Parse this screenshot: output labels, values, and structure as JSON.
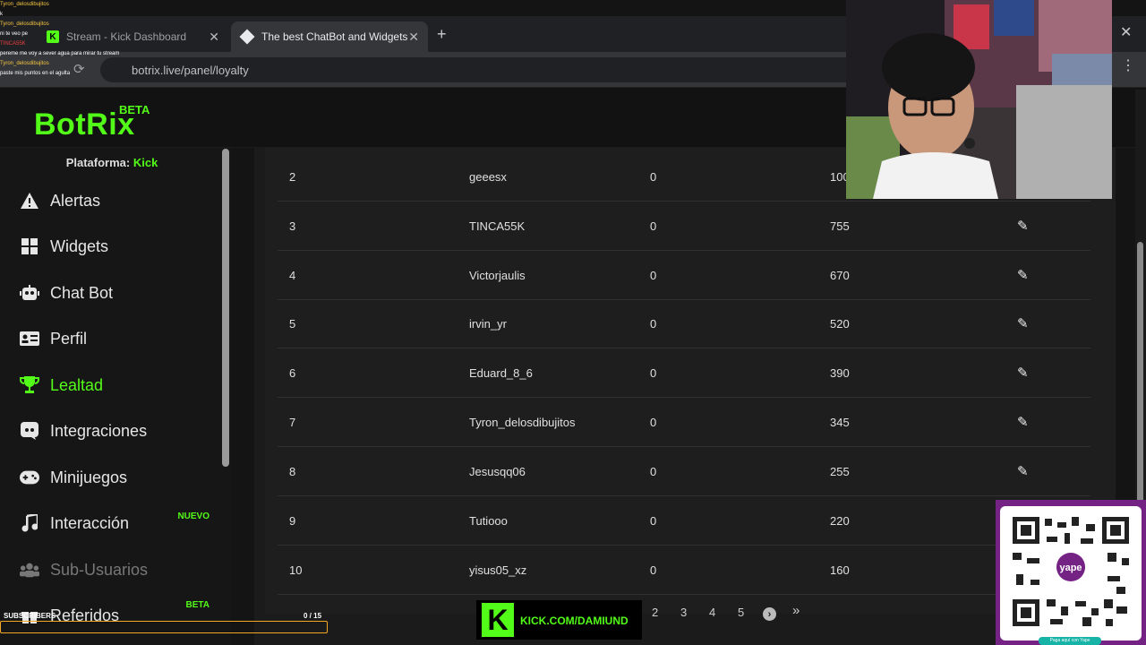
{
  "chat_overlay": {
    "lines": [
      {
        "user": "Tyron_delosdibujitos",
        "text": ""
      },
      {
        "user": "",
        "text": "k"
      },
      {
        "user": "Tyron_delosdibujitos",
        "text": ""
      },
      {
        "user": "",
        "text": "ni te veo pe"
      },
      {
        "user": "TINCA55K",
        "text": ""
      },
      {
        "user": "",
        "text": "pereme me voy a sever agua para mirar tu stream"
      },
      {
        "user": "Tyron_delosdibujitos",
        "text": ""
      },
      {
        "user": "",
        "text": "paste mis puntos en el agulta"
      }
    ]
  },
  "browser": {
    "tabs": [
      {
        "label": "Stream - Kick Dashboard",
        "active": false
      },
      {
        "label": "The best ChatBot and Widgets",
        "active": true
      }
    ],
    "new_tab_glyph": "+",
    "close_glyph": "✕",
    "url": "botrix.live/panel/loyalty"
  },
  "app": {
    "logo": "BotRix",
    "logo_badge": "BETA",
    "platform_label": "Plataforma:",
    "platform_value": "Kick"
  },
  "sidebar": {
    "items": [
      {
        "label": "Alertas",
        "icon": "warning-icon"
      },
      {
        "label": "Widgets",
        "icon": "grid-icon"
      },
      {
        "label": "Chat Bot",
        "icon": "robot-icon"
      },
      {
        "label": "Perfil",
        "icon": "id-card-icon"
      },
      {
        "label": "Lealtad",
        "icon": "trophy-icon",
        "active": true
      },
      {
        "label": "Integraciones",
        "icon": "discord-icon"
      },
      {
        "label": "Minijuegos",
        "icon": "gamepad-icon"
      },
      {
        "label": "Interacción",
        "icon": "music-icon",
        "tag": "NUEVO"
      },
      {
        "label": "Sub-Usuarios",
        "icon": "users-icon",
        "disabled": true
      },
      {
        "label": "Referidos",
        "icon": "gift-icon",
        "tag": "BETA"
      }
    ]
  },
  "table": {
    "rows": [
      {
        "rank": "2",
        "user": "geeesx",
        "value": "0",
        "points": "100"
      },
      {
        "rank": "3",
        "user": "TINCA55K",
        "value": "0",
        "points": "755"
      },
      {
        "rank": "4",
        "user": "Victorjaulis",
        "value": "0",
        "points": "670"
      },
      {
        "rank": "5",
        "user": "irvin_yr",
        "value": "0",
        "points": "520"
      },
      {
        "rank": "6",
        "user": "Eduard_8_6",
        "value": "0",
        "points": "390"
      },
      {
        "rank": "7",
        "user": "Tyron_delosdibujitos",
        "value": "0",
        "points": "345"
      },
      {
        "rank": "8",
        "user": "Jesusqq06",
        "value": "0",
        "points": "255"
      },
      {
        "rank": "9",
        "user": "Tutiooo",
        "value": "0",
        "points": "220"
      },
      {
        "rank": "10",
        "user": "yisus05_xz",
        "value": "0",
        "points": "160"
      }
    ]
  },
  "pagination": {
    "pages": [
      "2",
      "3",
      "4",
      "5"
    ],
    "next_glyph": "›",
    "last_glyph": "»"
  },
  "stream_overlay": {
    "kick_url": "KICK.COM/DAMIUND",
    "sub_label": "SUBSCRIBERS",
    "sub_count": "0  / 15",
    "qr_footer": "Paga aquí con Yape"
  }
}
